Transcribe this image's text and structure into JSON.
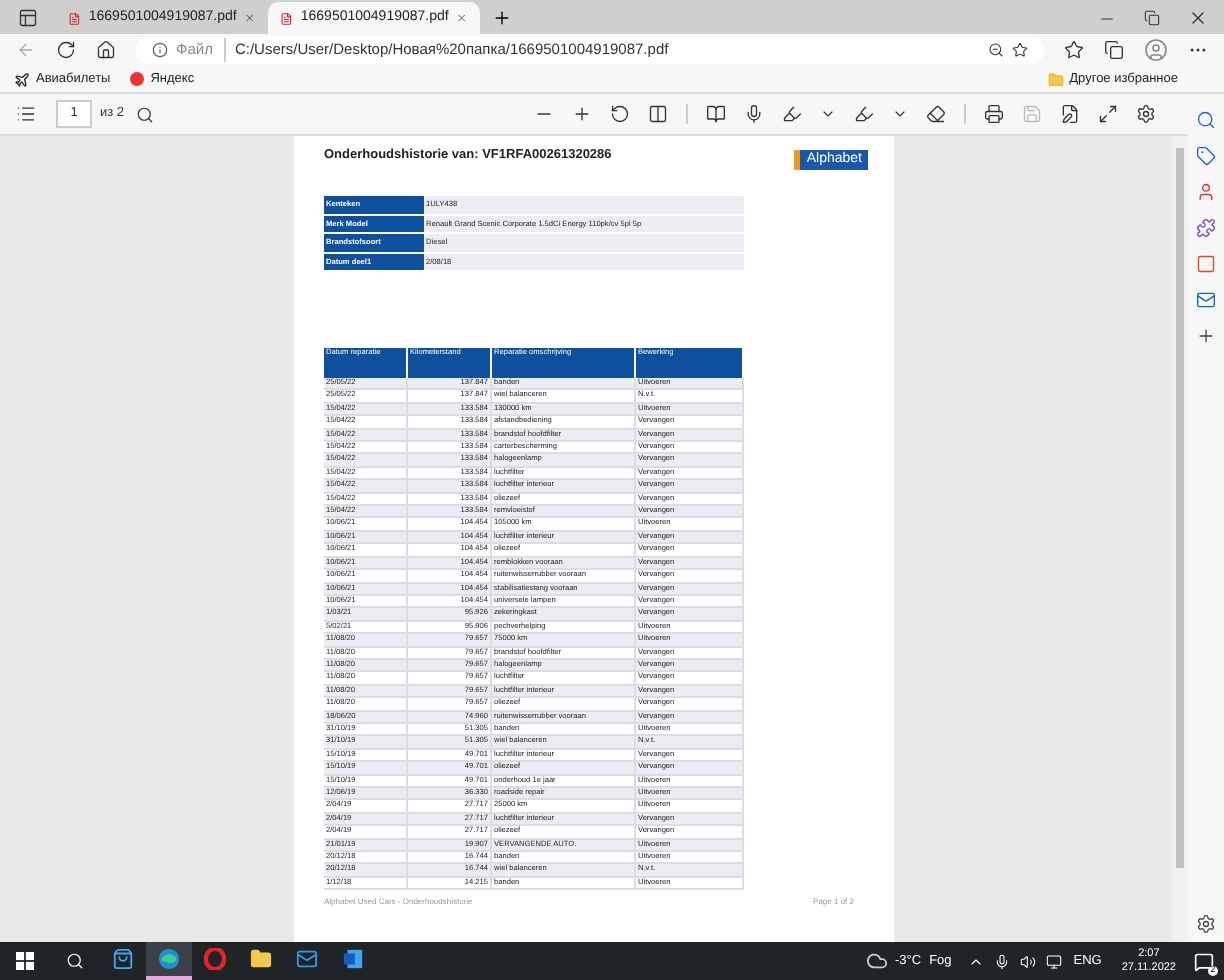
{
  "tabs": [
    {
      "title": "1669501004919087.pdf",
      "selected": false
    },
    {
      "title": "1669501004919087.pdf",
      "selected": true
    }
  ],
  "address": {
    "scheme": "Файл",
    "url": "C:/Users/User/Desktop/Новая%20папка/1669501004919087.pdf"
  },
  "bookmarks": [
    {
      "label": "Авиабилеты",
      "kind": "plane"
    },
    {
      "label": "Яндекс",
      "kind": "yandex"
    }
  ],
  "other_favorites": "Другое избранное",
  "pdf_toolbar": {
    "page": "1",
    "total": "из 2"
  },
  "document": {
    "title": "Onderhoudshistorie van: VF1RFA00261320286",
    "logo": "Alphabet",
    "info": [
      {
        "label": "Kenteken",
        "value": "1ULY438"
      },
      {
        "label": "Merk Model",
        "value": "Renault  Grand Scenic Corporate 1.5dCi Energy 110pk/cv 5pl 5p"
      },
      {
        "label": "Brandstofsoort",
        "value": "Diesel"
      },
      {
        "label": "Datum deel1",
        "value": "2/08/18"
      }
    ],
    "columns": [
      "Datum reparatie",
      "Kilometerstand",
      "Reparatie omschrijving",
      "Bewerking"
    ],
    "rows": [
      [
        "25/05/22",
        "137.847",
        "banden",
        "Uitvoeren"
      ],
      [
        "25/05/22",
        "137.847",
        "wiel balanceren",
        "N.v.t."
      ],
      [
        "15/04/22",
        "133.584",
        "130000 km",
        "Uitvoeren"
      ],
      [
        "15/04/22",
        "133.584",
        "afstandbediening",
        "Vervangen"
      ],
      [
        "15/04/22",
        "133.584",
        "brandstof hoofdfilter",
        "Vervangen"
      ],
      [
        "15/04/22",
        "133.584",
        "carterbescherming",
        "Vervangen"
      ],
      [
        "15/04/22",
        "133.584",
        "halogeenlamp",
        "Vervangen"
      ],
      [
        "15/04/22",
        "133.584",
        "luchtfilter",
        "Vervangen"
      ],
      [
        "15/04/22",
        "133.584",
        "luchtfilter interieur",
        "Vervangen"
      ],
      [
        "15/04/22",
        "133.584",
        "oliezeef",
        "Vervangen"
      ],
      [
        "15/04/22",
        "133.584",
        "remvloeistof",
        "Vervangen"
      ],
      [
        "10/06/21",
        "104.454",
        "105000 km",
        "Uitvoeren"
      ],
      [
        "10/06/21",
        "104.454",
        "luchtfilter interieur",
        "Vervangen"
      ],
      [
        "10/06/21",
        "104.454",
        "oliezeef",
        "Vervangen"
      ],
      [
        "10/06/21",
        "104.454",
        "remblokken vooraan",
        "Vervangen"
      ],
      [
        "10/06/21",
        "104.454",
        "ruitenwisserrubber vooraan",
        "Vervangen"
      ],
      [
        "10/06/21",
        "104.454",
        "stabilisatiestang vooraan",
        "Vervangen"
      ],
      [
        "10/06/21",
        "104.454",
        "universele lampen",
        "Vervangen"
      ],
      [
        "1/03/21",
        "95.926",
        "zekeringkast",
        "Vervangen"
      ],
      [
        "5/02/21",
        "95.906",
        "pechverhelping",
        "Uitvoeren"
      ],
      [
        "11/08/20",
        "79.657",
        "75000 km",
        "Uitvoeren"
      ],
      [
        "11/08/20",
        "79.657",
        "brandstof hoofdfilter",
        "Vervangen"
      ],
      [
        "11/08/20",
        "79.657",
        "halogeenlamp",
        "Vervangen"
      ],
      [
        "11/08/20",
        "79.657",
        "luchtfilter",
        "Vervangen"
      ],
      [
        "11/08/20",
        "79.657",
        "luchtfilter interieur",
        "Vervangen"
      ],
      [
        "11/08/20",
        "79.657",
        "oliezeef",
        "Vervangen"
      ],
      [
        "18/06/20",
        "74.960",
        "ruitenwisserrubber vooraan",
        "Vervangen"
      ],
      [
        "31/10/19",
        "51.305",
        "banden",
        "Uitvoeren"
      ],
      [
        "31/10/19",
        "51.305",
        "wiel balanceren",
        "N.v.t."
      ],
      [
        "15/10/19",
        "49.701",
        "luchtfilter interieur",
        "Vervangen"
      ],
      [
        "15/10/19",
        "49.701",
        "oliezeef",
        "Vervangen"
      ],
      [
        "15/10/19",
        "49.701",
        "onderhoud 1e jaar",
        "Uitvoeren"
      ],
      [
        "12/06/19",
        "36.330",
        "roadside repair",
        "Uitvoeren"
      ],
      [
        "2/04/19",
        "27.717",
        "25000 km",
        "Uitvoeren"
      ],
      [
        "2/04/19",
        "27.717",
        "luchtfilter interieur",
        "Vervangen"
      ],
      [
        "2/04/19",
        "27.717",
        "oliezeef",
        "Vervangen"
      ],
      [
        "21/01/19",
        "19.907",
        "VERVANGENDE AUTO.",
        "Uitvoeren"
      ],
      [
        "20/12/18",
        "16.744",
        "banden",
        "Uitvoeren"
      ],
      [
        "20/12/18",
        "16.744",
        "wiel balanceren",
        "N.v.t."
      ],
      [
        "1/12/18",
        "14.215",
        "banden",
        "Uitvoeren"
      ]
    ],
    "footer_left": "Alphabet  Used Cars - Onderhoudshistorie",
    "footer_right": "Page 1 of 2"
  },
  "taskbar": {
    "apps": [
      {
        "kind": "store",
        "active": false
      },
      {
        "kind": "edge",
        "active": true
      },
      {
        "kind": "opera",
        "active": false
      },
      {
        "kind": "explorer",
        "active": false
      },
      {
        "kind": "mail",
        "active": false
      },
      {
        "kind": "word",
        "active": false
      }
    ],
    "temperature": "-3°C",
    "weather": "Fog",
    "language": "ENG",
    "time": "2:07",
    "date": "27.11.2022",
    "notifications": "2"
  }
}
